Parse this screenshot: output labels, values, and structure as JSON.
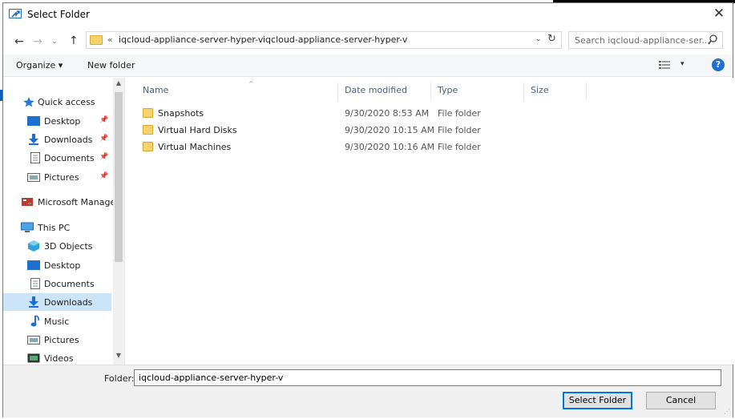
{
  "window": {
    "title": "Select Folder",
    "close_glyph": "✕"
  },
  "nav_buttons": {
    "back": "←",
    "forward": "→",
    "recent": "⌄",
    "up": "↑"
  },
  "address": {
    "overflow": "«",
    "crumbs": [
      "iqcloud-appliance-server-hyper-v",
      "iqcloud-appliance-server-hyper-v"
    ],
    "separator": "›",
    "dropdown": "⌄",
    "refresh": "↻"
  },
  "search": {
    "placeholder": "Search iqcloud-appliance-ser..."
  },
  "toolbar": {
    "organize": "Organize ▾",
    "new_folder": "New folder",
    "view_dropdown": "▾",
    "help": "?"
  },
  "sidebar": {
    "items": [
      {
        "label": "Quick access",
        "icon": "star-icon",
        "pinned": false
      },
      {
        "label": "Desktop",
        "icon": "desktop-icon",
        "pinned": true
      },
      {
        "label": "Downloads",
        "icon": "download-icon",
        "pinned": true
      },
      {
        "label": "Documents",
        "icon": "document-icon",
        "pinned": true
      },
      {
        "label": "Pictures",
        "icon": "pictures-icon",
        "pinned": true
      },
      {
        "label": "Microsoft Manage",
        "icon": "server-icon",
        "pinned": false
      },
      {
        "label": "This PC",
        "icon": "computer-icon",
        "pinned": false
      },
      {
        "label": "3D Objects",
        "icon": "cube-icon",
        "pinned": false
      },
      {
        "label": "Desktop",
        "icon": "desktop-icon",
        "pinned": false
      },
      {
        "label": "Documents",
        "icon": "document-icon",
        "pinned": false
      },
      {
        "label": "Downloads",
        "icon": "download-icon",
        "pinned": false,
        "selected": true
      },
      {
        "label": "Music",
        "icon": "music-icon",
        "pinned": false
      },
      {
        "label": "Pictures",
        "icon": "pictures-icon",
        "pinned": false
      },
      {
        "label": "Videos",
        "icon": "video-icon",
        "pinned": false
      }
    ],
    "pin_glyph": "📌"
  },
  "filelist": {
    "columns": [
      "Name",
      "Date modified",
      "Type",
      "Size"
    ],
    "sort_glyph": "^",
    "rows": [
      {
        "name": "Snapshots",
        "date": "9/30/2020 8:53 AM",
        "type": "File folder",
        "size": ""
      },
      {
        "name": "Virtual Hard Disks",
        "date": "9/30/2020 10:15 AM",
        "type": "File folder",
        "size": ""
      },
      {
        "name": "Virtual Machines",
        "date": "9/30/2020 10:16 AM",
        "type": "File folder",
        "size": ""
      }
    ]
  },
  "footer": {
    "folder_label": "Folder:",
    "folder_value": "iqcloud-appliance-server-hyper-v",
    "select_button": "Select Folder",
    "cancel_button": "Cancel"
  },
  "colors": {
    "accent": "#0078d7",
    "selection": "#cce4f7",
    "folder": "#f6d26a"
  }
}
